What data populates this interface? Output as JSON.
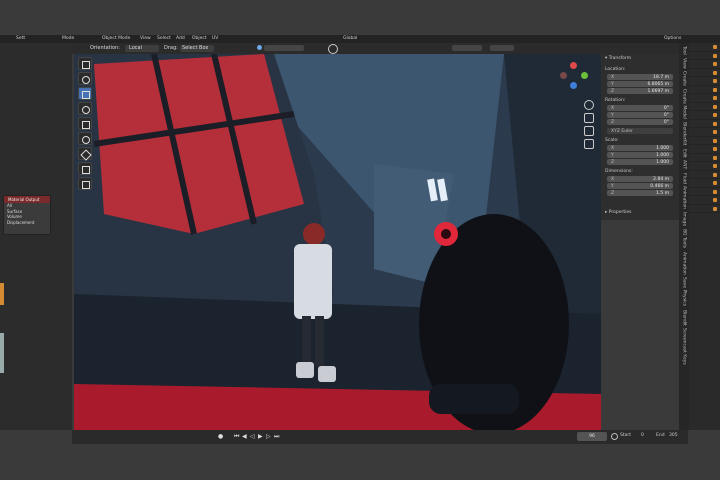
{
  "topbar": {
    "left_items": [
      "Sett",
      "Mode",
      "Object Mode",
      "View",
      "Select",
      "Add",
      "Object",
      "UV"
    ],
    "global": "Global",
    "options": "Options"
  },
  "header": {
    "orientation_label": "Orientation:",
    "orientation_value": "Local",
    "drag_label": "Drag:",
    "drag_value": "Select Box"
  },
  "node": {
    "title": "Material Output",
    "rows": [
      "All",
      "Surface",
      "Volume",
      "Displacement"
    ]
  },
  "npanel": {
    "title": "Transform",
    "location_label": "Location:",
    "location": [
      {
        "axis": "X",
        "value": "18.7 m"
      },
      {
        "axis": "Y",
        "value": "6.8065 m"
      },
      {
        "axis": "Z",
        "value": "1.6697 m"
      }
    ],
    "rotation_label": "Rotation:",
    "rotation": [
      {
        "axis": "X",
        "value": "0°"
      },
      {
        "axis": "Y",
        "value": "0°"
      },
      {
        "axis": "Z",
        "value": "0°"
      }
    ],
    "rotation_mode": "XYZ Euler",
    "scale_label": "Scale:",
    "scale": [
      {
        "axis": "X",
        "value": "1.000"
      },
      {
        "axis": "Y",
        "value": "1.000"
      },
      {
        "axis": "Z",
        "value": "1.000"
      }
    ],
    "dimensions_label": "Dimensions:",
    "dimensions": [
      {
        "axis": "X",
        "value": "2.84 m"
      },
      {
        "axis": "Y",
        "value": "0.466 m"
      },
      {
        "axis": "Z",
        "value": "1.5 m"
      }
    ],
    "properties_label": "Properties"
  },
  "tabs": [
    "Tool",
    "View",
    "Create",
    "Create Model",
    "BlenderKit",
    "Edit",
    "ANT",
    "Fluid",
    "Animation",
    "Image",
    "BG Tools",
    "Animation",
    "Save Physics",
    "Blendit",
    "Screencast Keys"
  ],
  "timeline": {
    "current_frame": "96",
    "start_label": "Start",
    "start": "0",
    "end_label": "End",
    "end": "305"
  },
  "colors": {
    "accent": "#4772b3",
    "viewport_red": "#e0283a"
  }
}
